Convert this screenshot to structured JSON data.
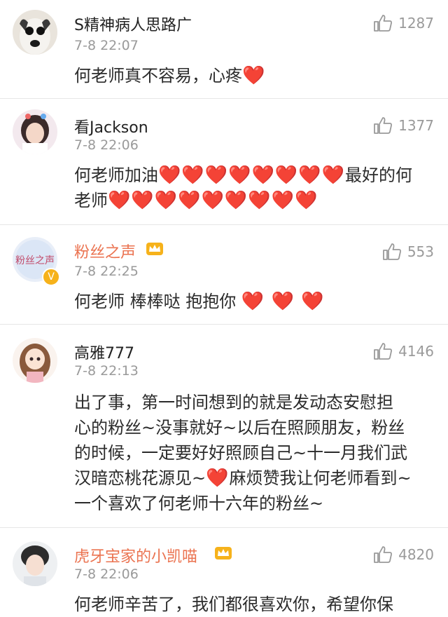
{
  "comments": [
    {
      "username": "S精神病人思路广",
      "time": "7-8 22:07",
      "likes": "1287",
      "text": "何老师真不容易，心疼",
      "hearts_after": "❤️"
    },
    {
      "username": "看Jackson",
      "time": "7-8 22:06",
      "likes": "1377",
      "text_a": "何老师加油",
      "hearts_a": "❤️❤️❤️❤️❤️❤️❤️❤️",
      "text_b": "最好的何",
      "text_c": "老师",
      "hearts_c": "❤️❤️❤️❤️❤️❤️❤️❤️❤️"
    },
    {
      "username": "粉丝之声",
      "avatar_text": "粉丝之声",
      "time": "7-8 22:25",
      "likes": "553",
      "text": "何老师 棒棒哒 抱抱你",
      "hearts_after": "❤️ ❤️ ❤️"
    },
    {
      "username": "高雅777",
      "time": "7-8 22:13",
      "likes": "4146",
      "lines": [
        "出了事，第一时间想到的就是发动态安慰担",
        "心的粉丝~没事就好~以后在照顾朋友，粉丝",
        "的时候，一定要好好照顾自己~十一月我们武"
      ],
      "line4_a": "汉暗恋桃花源见~",
      "line4_heart": "❤️",
      "line4_b": "麻烦赞我让何老师看到~",
      "line5": "一个喜欢了何老师十六年的粉丝~"
    },
    {
      "username": "虎牙宝家的小凯喵",
      "time": "7-8 22:06",
      "likes": "4820",
      "text": "何老师辛苦了，我们都很喜欢你，希望你保"
    }
  ],
  "icons": {
    "like": "thumbs-up-icon",
    "vip": "crown-icon",
    "verified": "verified-v-icon"
  },
  "colors": {
    "vip_name": "#eb7350",
    "meta": "#9a9a9a",
    "heart": "#e0201f",
    "badge": "#f6b21b"
  },
  "verified_mark": "V"
}
